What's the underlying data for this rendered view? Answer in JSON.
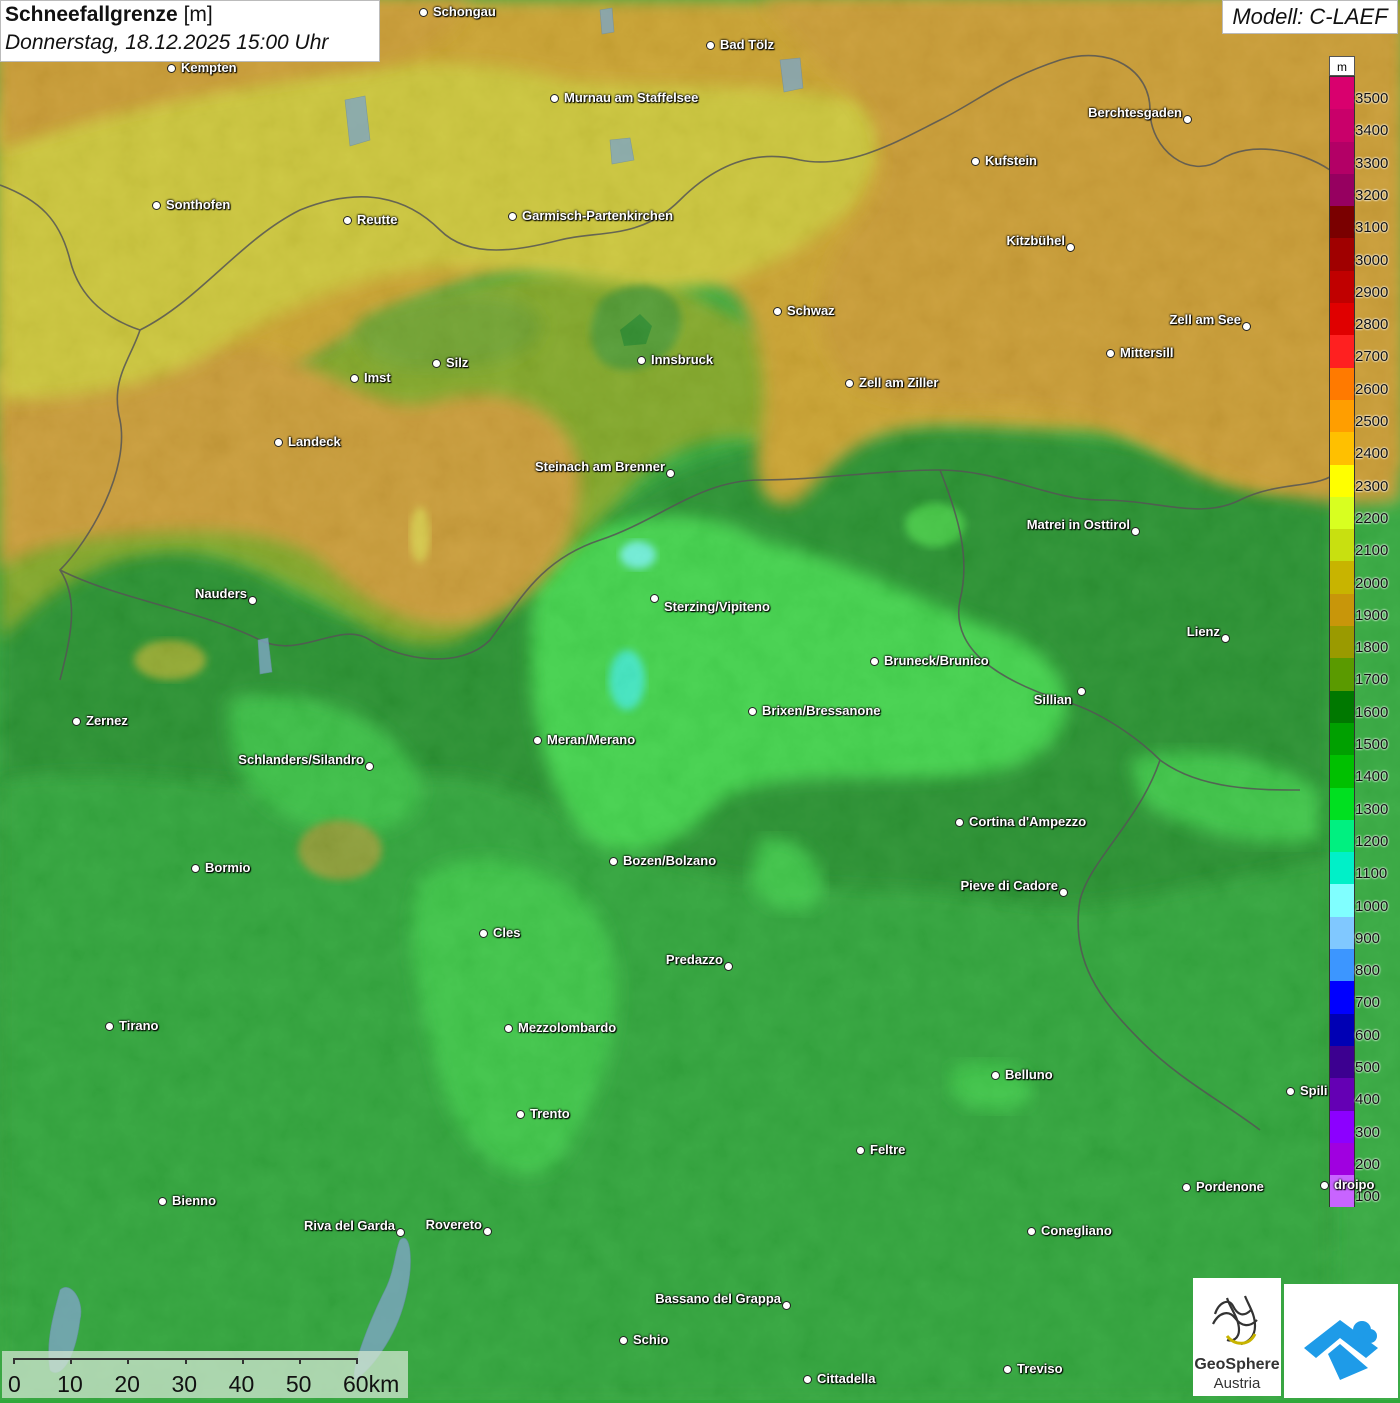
{
  "title": {
    "parameter": "Schneefallgrenze",
    "unit": "[m]",
    "datetime": "Donnerstag, 18.12.2025 15:00 Uhr"
  },
  "model": "Modell: C-LAEF",
  "legend": {
    "unit": "m",
    "entries": [
      {
        "value": "3500",
        "color": "#d9006e"
      },
      {
        "value": "3400",
        "color": "#c9006a"
      },
      {
        "value": "3300",
        "color": "#b30066"
      },
      {
        "value": "3200",
        "color": "#960060"
      },
      {
        "value": "3100",
        "color": "#7a0000"
      },
      {
        "value": "3000",
        "color": "#a00000"
      },
      {
        "value": "2900",
        "color": "#c00000"
      },
      {
        "value": "2800",
        "color": "#e00000"
      },
      {
        "value": "2700",
        "color": "#ff2020"
      },
      {
        "value": "2600",
        "color": "#ff7a00"
      },
      {
        "value": "2500",
        "color": "#ff9e00"
      },
      {
        "value": "2400",
        "color": "#ffc000"
      },
      {
        "value": "2300",
        "color": "#ffff00"
      },
      {
        "value": "2200",
        "color": "#d8ff20"
      },
      {
        "value": "2100",
        "color": "#c8e010"
      },
      {
        "value": "2000",
        "color": "#c8b400"
      },
      {
        "value": "1900",
        "color": "#c8960a"
      },
      {
        "value": "1800",
        "color": "#9a9a00"
      },
      {
        "value": "1700",
        "color": "#5a9a00"
      },
      {
        "value": "1600",
        "color": "#007800"
      },
      {
        "value": "1500",
        "color": "#00a000"
      },
      {
        "value": "1400",
        "color": "#00c000"
      },
      {
        "value": "1300",
        "color": "#00e020"
      },
      {
        "value": "1200",
        "color": "#00f080"
      },
      {
        "value": "1100",
        "color": "#00f0c8"
      },
      {
        "value": "1000",
        "color": "#80ffff"
      },
      {
        "value": "900",
        "color": "#80c8ff"
      },
      {
        "value": "800",
        "color": "#3c96ff"
      },
      {
        "value": "700",
        "color": "#0000ff"
      },
      {
        "value": "600",
        "color": "#0000b4"
      },
      {
        "value": "500",
        "color": "#3c0090"
      },
      {
        "value": "400",
        "color": "#6400b4"
      },
      {
        "value": "300",
        "color": "#8c00ff"
      },
      {
        "value": "200",
        "color": "#a000e0"
      },
      {
        "value": "100",
        "color": "#c864ff"
      }
    ]
  },
  "cities": [
    {
      "name": "Schongau"
    },
    {
      "name": "Bad Tölz"
    },
    {
      "name": "Kempten"
    },
    {
      "name": "Murnau am Staffelsee"
    },
    {
      "name": "Berchtesgaden"
    },
    {
      "name": "Kufstein"
    },
    {
      "name": "Sonthofen"
    },
    {
      "name": "Reutte"
    },
    {
      "name": "Garmisch-Partenkirchen"
    },
    {
      "name": "Kitzbühel"
    },
    {
      "name": "Schwaz"
    },
    {
      "name": "Zell am See"
    },
    {
      "name": "Innsbruck"
    },
    {
      "name": "Mittersill"
    },
    {
      "name": "Silz"
    },
    {
      "name": "Imst"
    },
    {
      "name": "Zell am Ziller"
    },
    {
      "name": "Landeck"
    },
    {
      "name": "Steinach am Brenner"
    },
    {
      "name": "Matrei in Osttirol"
    },
    {
      "name": "Nauders"
    },
    {
      "name": "Sterzing/Vipiteno"
    },
    {
      "name": "Lienz"
    },
    {
      "name": "Bruneck/Brunico"
    },
    {
      "name": "Sillian"
    },
    {
      "name": "Zernez"
    },
    {
      "name": "Brixen/Bressanone"
    },
    {
      "name": "Meran/Merano"
    },
    {
      "name": "Schlanders/Silandro"
    },
    {
      "name": "Cortina d'Ampezzo"
    },
    {
      "name": "Bozen/Bolzano"
    },
    {
      "name": "Bormio"
    },
    {
      "name": "Pieve di Cadore"
    },
    {
      "name": "Cles"
    },
    {
      "name": "Predazzo"
    },
    {
      "name": "Tirano"
    },
    {
      "name": "Mezzolombardo"
    },
    {
      "name": "Belluno"
    },
    {
      "name": "Spili"
    },
    {
      "name": "Trento"
    },
    {
      "name": "Feltre"
    },
    {
      "name": "Bienno"
    },
    {
      "name": "Pordenone"
    },
    {
      "name": "droipo"
    },
    {
      "name": "Riva del Garda"
    },
    {
      "name": "Rovereto"
    },
    {
      "name": "Conegliano"
    },
    {
      "name": "Bassano del Grappa"
    },
    {
      "name": "Schio"
    },
    {
      "name": "Treviso"
    },
    {
      "name": "Cittadella"
    }
  ],
  "scale": {
    "labels": [
      "0",
      "10",
      "20",
      "30",
      "40",
      "50",
      "60km"
    ]
  },
  "logo": {
    "line1": "GeoSphere",
    "line2": "Austria"
  }
}
